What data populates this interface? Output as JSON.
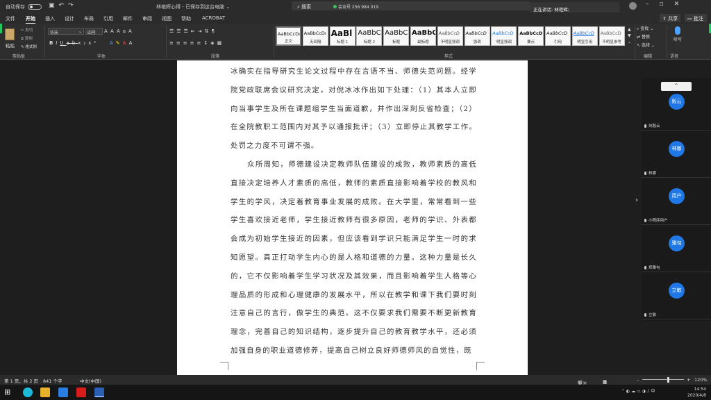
{
  "titlebar": {
    "autosave_label": "自动保存",
    "autosave_state": "关",
    "doc_title": "林艳辉心得 - 已保存到这台电脑 ⌄",
    "search_label": "搜索",
    "meeting_label": "会议号 256 984 019",
    "speaking_label": "正在讲话: 林艳辉;"
  },
  "tabs": [
    "文件",
    "开始",
    "插入",
    "设计",
    "布局",
    "引用",
    "邮件",
    "审阅",
    "视图",
    "帮助",
    "ACROBAT"
  ],
  "active_tab": "开始",
  "share_label": "共享",
  "comment_label": "批注",
  "clipboard": {
    "paste_label": "粘贴",
    "cut_label": "剪切",
    "copy_label": "复制",
    "format_painter_label": "格式刷",
    "group_label": "剪贴板"
  },
  "font": {
    "font_name": "仿宋",
    "font_size": "四号",
    "group_label": "字体"
  },
  "paragraph": {
    "group_label": "段落"
  },
  "styles": {
    "group_label": "样式",
    "items": [
      {
        "sample": "AaBbCcDı",
        "name": "正文"
      },
      {
        "sample": "AaBbCcDı",
        "name": "无间隔"
      },
      {
        "sample": "AaBl",
        "name": "标题 1"
      },
      {
        "sample": "AaBbC",
        "name": "标题 2"
      },
      {
        "sample": "AaBbC",
        "name": "标题"
      },
      {
        "sample": "AaBbC",
        "name": "副标题"
      },
      {
        "sample": "AaBbCcD",
        "name": "不明显强调"
      },
      {
        "sample": "AaBbCcD",
        "name": "强调"
      },
      {
        "sample": "AaBbCcD",
        "name": "明显强调"
      },
      {
        "sample": "AaBbCcD",
        "name": "要点"
      },
      {
        "sample": "AaBbCcD",
        "name": "引用"
      },
      {
        "sample": "AaBbCcD",
        "name": "明显引用"
      },
      {
        "sample": "AaBbCcD",
        "name": "不明显参考"
      }
    ]
  },
  "editing": {
    "find_label": "查找",
    "replace_label": "替换",
    "select_label": "选择",
    "group_label": "编辑"
  },
  "voice": {
    "dictate_label": "听写",
    "group_label": "语音"
  },
  "document": {
    "paragraphs": [
      "冰确实在指导研究生论文过程中存在言语不当、师德失范问题。经学院党政联席会议研究决定，对倪冰冰作出如下处理：（1）其本人立即向当事学生及所在课题组学生当面道歉，并作出深刻反省检查；（2）在全院教职工范围内对其予以通报批评；（3）立即停止其教学工作。处罚之力度不可谓不强。",
      "众所周知，师德建设决定教师队伍建设的成败，教师素质的高低直接决定培养人才素质的高低，教师的素质直接影响着学校的教风和学生的学风，决定着教育事业发展的成败。在大学里，常常看到一些学生喜欢接近老师，学生接近教师有很多原因，老师的学识、外表都会成为初始学生接近的因素，但应该看到学识只能满足学生一时的求知愿望。真正打动学生内心的是人格和道德的力量。这种力量是长久的，它不仅影响着学生学习状况及其效果，而且影响着学生人格等心理品质的形成和心理健康的发展水平，所以在教学和课下我们要时刻注意自己的言行，做学生的典范。这不仅要求我们需要不断更新教育理念，完善自己的知识结构，逐步提升自己的教育教学水平，还必须加强自身的职业道德修养，提高自己树立良好师德师风的自觉性，既"
    ]
  },
  "participants": [
    {
      "avatar": "毅云",
      "name": "刘毅云"
    },
    {
      "avatar": "林娜",
      "name": "林娜"
    },
    {
      "avatar": "用户",
      "name": "小程序用户"
    },
    {
      "avatar": "雅勾",
      "name": "郑雅勾"
    },
    {
      "avatar": "立敏",
      "name": "立敏"
    }
  ],
  "statusbar": {
    "page": "第 1 页，共 2 页",
    "words": "841 个字",
    "lang": "中文(中国)",
    "focus": "专注",
    "zoom": "120%"
  },
  "taskbar": {
    "time": "14:54",
    "date": "2020/4/8",
    "ime": "中"
  },
  "colors": {
    "accent": "#1f78e6",
    "share_border": "#22c55e"
  }
}
